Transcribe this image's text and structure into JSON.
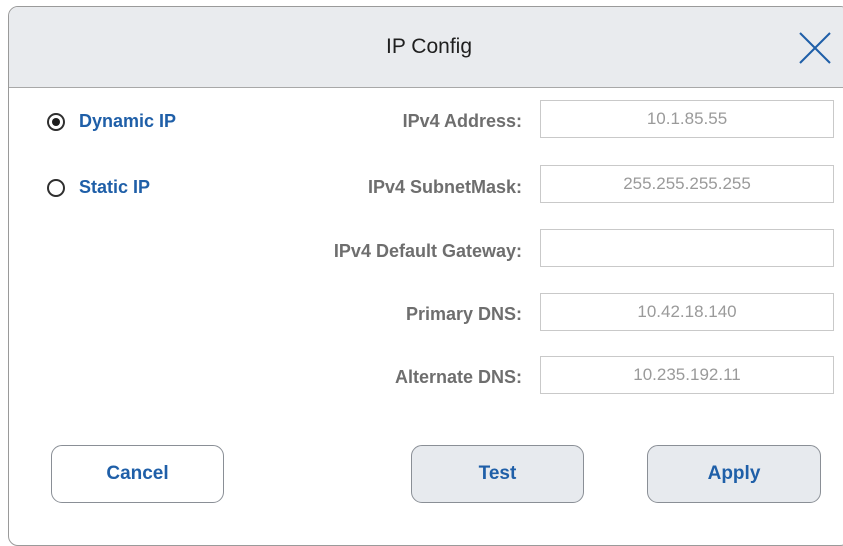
{
  "dialog": {
    "title": "IP Config",
    "close_icon": "close-icon"
  },
  "mode": {
    "selected": "dynamic",
    "options": [
      {
        "id": "dynamic",
        "label": "Dynamic IP",
        "checked": true
      },
      {
        "id": "static",
        "label": "Static IP",
        "checked": false
      }
    ]
  },
  "fields": {
    "ipv4_address": {
      "label": "IPv4 Address:",
      "value": "10.1.85.55"
    },
    "subnet_mask": {
      "label": "IPv4 SubnetMask:",
      "value": "255.255.255.255"
    },
    "default_gateway": {
      "label": "IPv4 Default Gateway:",
      "value": ""
    },
    "primary_dns": {
      "label": "Primary DNS:",
      "value": "10.42.18.140"
    },
    "alternate_dns": {
      "label": "Alternate DNS:",
      "value": "10.235.192.11"
    }
  },
  "buttons": {
    "cancel": "Cancel",
    "test": "Test",
    "apply": "Apply"
  },
  "colors": {
    "accent": "#1f5fa8",
    "label_gray": "#6e6e6e",
    "value_gray": "#9a9a9a",
    "titlebar_bg": "#e9ebee"
  }
}
